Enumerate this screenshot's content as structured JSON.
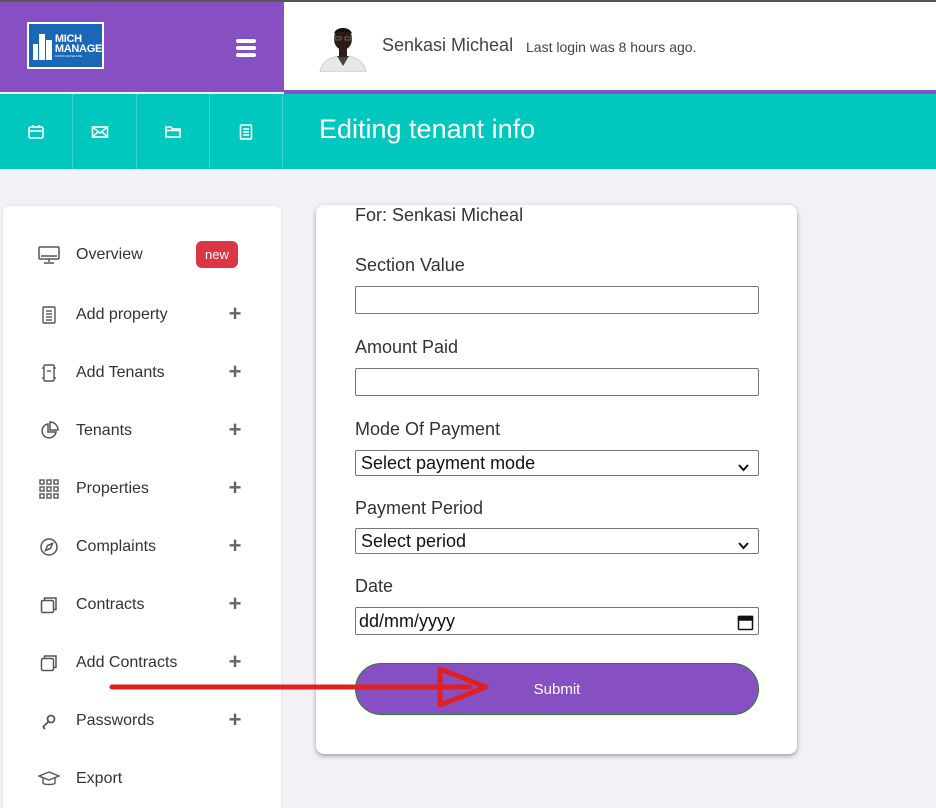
{
  "brand": {
    "logo_line1": "MICH",
    "logo_line2": "MANAGE",
    "logo_tagline": "FASTER AND SECURE",
    "brand_color": "#8650c3"
  },
  "header": {
    "user_name": "Senkasi Micheal",
    "last_login": "Last login was 8 hours ago."
  },
  "toolbar": {
    "icons": [
      "calendar-icon",
      "envelope-icon",
      "folder-icon",
      "document-icon"
    ],
    "page_title": "Editing tenant info",
    "accent_color": "#00c8be"
  },
  "sidebar": {
    "items": [
      {
        "label": "Overview",
        "icon": "monitor-icon",
        "badge": "new"
      },
      {
        "label": "Add property",
        "icon": "document-icon"
      },
      {
        "label": "Add Tenants",
        "icon": "tenant-icon"
      },
      {
        "label": "Tenants",
        "icon": "pie-chart-icon"
      },
      {
        "label": "Properties",
        "icon": "grid-icon"
      },
      {
        "label": "Complaints",
        "icon": "compass-icon"
      },
      {
        "label": "Contracts",
        "icon": "copy-icon"
      },
      {
        "label": "Add Contracts",
        "icon": "copy-icon"
      },
      {
        "label": "Passwords",
        "icon": "key-icon"
      },
      {
        "label": "Export",
        "icon": "graduation-cap-icon"
      }
    ],
    "plus": "+"
  },
  "form": {
    "for_text": "For: Senkasi Micheal",
    "section_value_label": "Section Value",
    "section_value": "",
    "amount_paid_label": "Amount Paid",
    "amount_paid": "",
    "mode_label": "Mode Of Payment",
    "mode_selected": "Select payment mode",
    "period_label": "Payment Period",
    "period_selected": "Select period",
    "date_label": "Date",
    "date_placeholder": "dd/mm/yyyy",
    "submit_label": "Submit"
  },
  "annotation": {
    "arrow_color": "#e02020"
  }
}
